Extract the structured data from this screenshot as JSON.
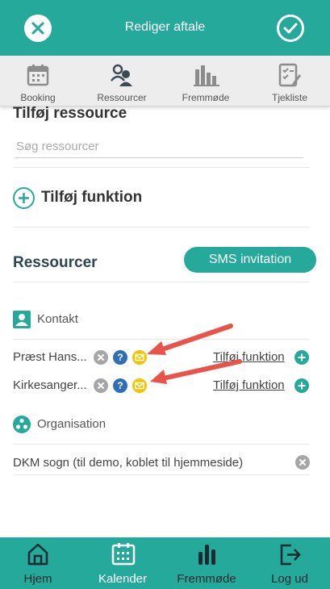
{
  "header": {
    "title": "Rediger aftale",
    "close_icon": "close-icon",
    "confirm_icon": "check-icon"
  },
  "tabs": [
    {
      "label": "Booking",
      "icon": "calendar-icon"
    },
    {
      "label": "Ressourcer",
      "icon": "people-icon"
    },
    {
      "label": "Fremmøde",
      "icon": "bar-chart-icon"
    },
    {
      "label": "Tjekliste",
      "icon": "checklist-icon"
    }
  ],
  "content": {
    "add_resource_heading": "Tilføj ressource",
    "search_placeholder": "Søg ressourcer",
    "add_function_label": "Tilføj funktion",
    "resources_title": "Ressourcer",
    "sms_button": "SMS invitation",
    "contact_group": {
      "label": "Kontakt",
      "rows": [
        {
          "name": "Præst Hans...",
          "link": "Tilføj funktion"
        },
        {
          "name": "Kirkesanger...",
          "link": "Tilføj funktion"
        }
      ]
    },
    "organisation_group": {
      "label": "Organisation",
      "rows": [
        {
          "name": "DKM sogn (til demo, koblet til hjemmeside)"
        }
      ]
    }
  },
  "bottom_nav": [
    {
      "label": "Hjem",
      "icon": "home-icon"
    },
    {
      "label": "Kalender",
      "icon": "calendar-icon"
    },
    {
      "label": "Fremmøde",
      "icon": "bar-chart-icon"
    },
    {
      "label": "Log ud",
      "icon": "logout-icon"
    }
  ],
  "colors": {
    "accent": "#24a99b",
    "annotation_arrow": "#e8534a",
    "status_blue": "#2e6fb6",
    "status_yellow": "#f3c300"
  }
}
